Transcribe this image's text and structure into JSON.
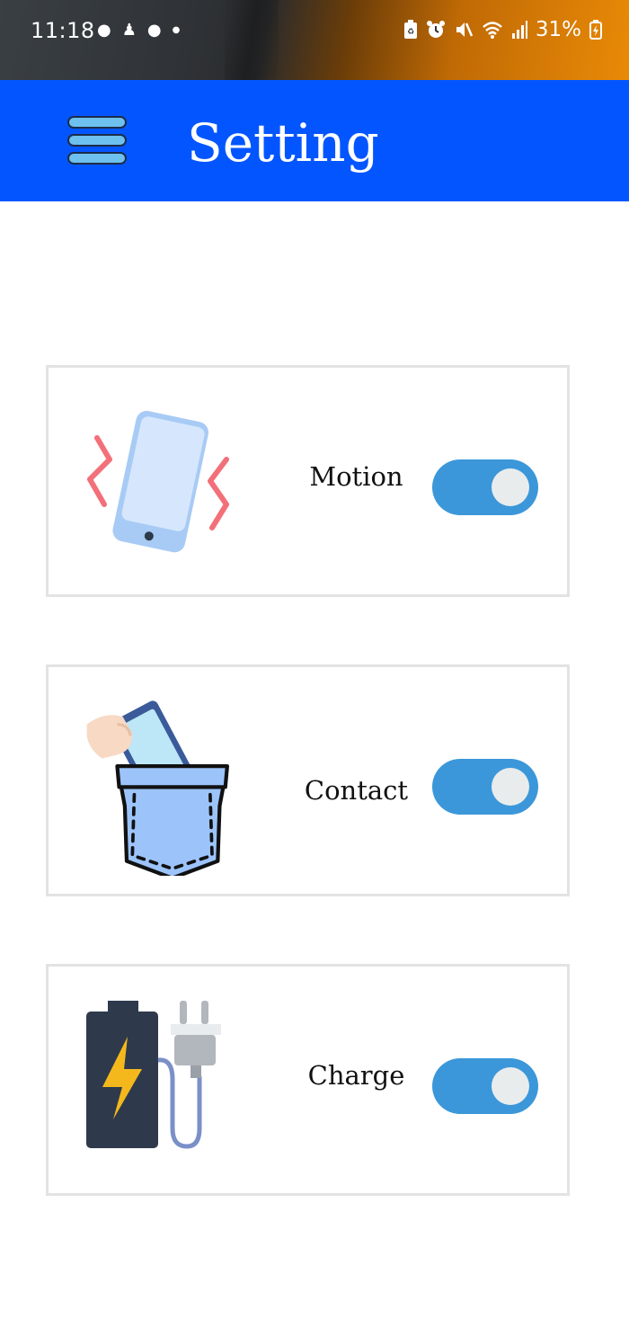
{
  "status_bar": {
    "time": "11:18",
    "left_icons": [
      "chat-bubble-icon",
      "person-icon",
      "chat-bubble-icon",
      "dot-icon"
    ],
    "right_icons": [
      "battery-saver-icon",
      "alarm-icon",
      "mute-icon",
      "wifi-icon",
      "signal-icon"
    ],
    "battery_percent": "31%"
  },
  "app_bar": {
    "title": "Setting",
    "color": "#0356ff"
  },
  "settings": [
    {
      "label": "Motion",
      "icon": "vibrating-phone-icon",
      "enabled": true
    },
    {
      "label": "Contact",
      "icon": "phone-in-pocket-icon",
      "enabled": true
    },
    {
      "label": "Charge",
      "icon": "battery-charger-icon",
      "enabled": true
    }
  ],
  "colors": {
    "toggle_on": "#3b97d9",
    "card_border": "#e3e3e3"
  }
}
